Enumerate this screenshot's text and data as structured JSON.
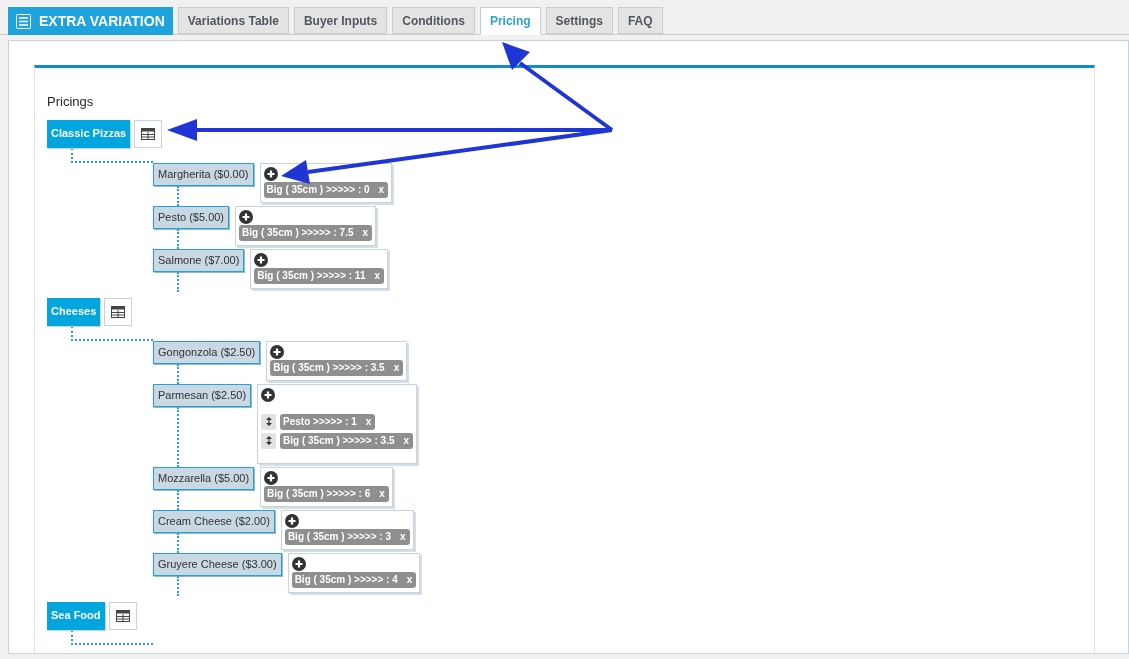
{
  "brand": {
    "title": "EXTRA VARIATION"
  },
  "tabs": [
    {
      "label": "Variations Table",
      "selected": false
    },
    {
      "label": "Buyer Inputs",
      "selected": false
    },
    {
      "label": "Conditions",
      "selected": false
    },
    {
      "label": "Pricing",
      "selected": true
    },
    {
      "label": "Settings",
      "selected": false
    },
    {
      "label": "FAQ",
      "selected": false
    }
  ],
  "heading": "Pricings",
  "groups": [
    {
      "name": "Classic Pizzas",
      "items": [
        {
          "label": "Margherita ($0.00)",
          "rules": [
            {
              "text": "Big ( 35cm ) >>>>> : 0",
              "remove": "x",
              "handle": false
            }
          ]
        },
        {
          "label": "Pesto ($5.00)",
          "rules": [
            {
              "text": "Big ( 35cm ) >>>>> : 7.5",
              "remove": "x",
              "handle": false
            }
          ]
        },
        {
          "label": "Salmone ($7.00)",
          "rules": [
            {
              "text": "Big ( 35cm ) >>>>> : 11",
              "remove": "x",
              "handle": false
            }
          ]
        }
      ]
    },
    {
      "name": "Cheeses",
      "items": [
        {
          "label": "Gongonzola ($2.50)",
          "rules": [
            {
              "text": "Big ( 35cm ) >>>>> : 3.5",
              "remove": "x",
              "handle": false
            }
          ]
        },
        {
          "label": "Parmesan ($2.50)",
          "rules": [
            {
              "text": "Pesto >>>>> : 1",
              "remove": "x",
              "handle": true
            },
            {
              "text": "Big ( 35cm ) >>>>> : 3.5",
              "remove": "x",
              "handle": true
            }
          ]
        },
        {
          "label": "Mozzarella ($5.00)",
          "rules": [
            {
              "text": "Big ( 35cm ) >>>>> : 6",
              "remove": "x",
              "handle": false
            }
          ]
        },
        {
          "label": "Cream Cheese ($2.00)",
          "rules": [
            {
              "text": "Big ( 35cm ) >>>>> : 3",
              "remove": "x",
              "handle": false
            }
          ]
        },
        {
          "label": "Gruyere Cheese ($3.00)",
          "rules": [
            {
              "text": "Big ( 35cm ) >>>>> : 4",
              "remove": "x",
              "handle": false
            }
          ]
        }
      ]
    },
    {
      "name": "Sea Food"
    }
  ]
}
